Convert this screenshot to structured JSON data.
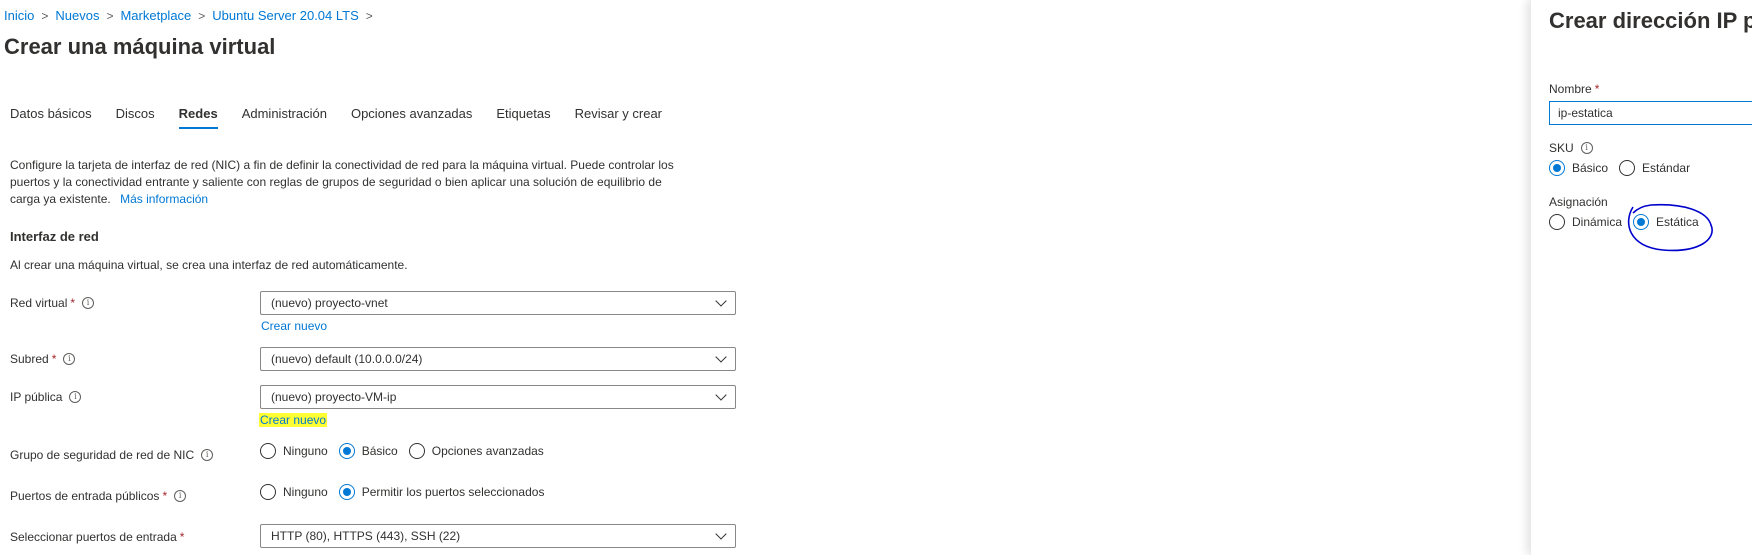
{
  "breadcrumb": {
    "items": [
      "Inicio",
      "Nuevos",
      "Marketplace",
      "Ubuntu Server 20.04 LTS"
    ],
    "separator": ">"
  },
  "page_title": "Crear una máquina virtual",
  "tabs": [
    "Datos básicos",
    "Discos",
    "Redes",
    "Administración",
    "Opciones avanzadas",
    "Etiquetas",
    "Revisar y crear"
  ],
  "active_tab": "Redes",
  "description": {
    "text": "Configure la tarjeta de interfaz de red (NIC) a fin de definir la conectividad de red para la máquina virtual. Puede controlar los puertos y la conectividad entrante y saliente con reglas de grupos de seguridad o bien aplicar una solución de equilibrio de carga ya existente.",
    "link": "Más información"
  },
  "network_interface": {
    "heading": "Interfaz de red",
    "note": "Al crear una máquina virtual, se crea una interfaz de red automáticamente."
  },
  "fields": {
    "vnet": {
      "label": "Red virtual",
      "required": "*",
      "value": "(nuevo) proyecto-vnet",
      "create_link": "Crear nuevo"
    },
    "subnet": {
      "label": "Subred",
      "required": "*",
      "value": "(nuevo) default (10.0.0.0/24)"
    },
    "public_ip": {
      "label": "IP pública",
      "value": "(nuevo) proyecto-VM-ip",
      "create_link": "Crear nuevo"
    },
    "nsg": {
      "label": "Grupo de seguridad de red de NIC",
      "options": [
        "Ninguno",
        "Básico",
        "Opciones avanzadas"
      ],
      "selected": "Básico"
    },
    "inbound": {
      "label": "Puertos de entrada públicos",
      "required": "*",
      "options": [
        "Ninguno",
        "Permitir los puertos seleccionados"
      ],
      "selected": "Permitir los puertos seleccionados"
    },
    "ports": {
      "label": "Seleccionar puertos de entrada",
      "required": "*",
      "value": "HTTP (80), HTTPS (443), SSH (22)"
    }
  },
  "side_panel": {
    "title": "Crear dirección IP pública",
    "name_label": "Nombre",
    "name_required": "*",
    "name_value": "ip-estatica",
    "sku_label": "SKU",
    "sku_options": [
      "Básico",
      "Estándar"
    ],
    "sku_selected": "Básico",
    "assignment_label": "Asignación",
    "assignment_options": [
      "Dinámica",
      "Estática"
    ],
    "assignment_selected": "Estática"
  },
  "colors": {
    "accent": "#0078d4",
    "required": "#a4262c",
    "highlight": "#ffff33",
    "annotation": "#0000cc"
  },
  "icons": [
    "info-icon",
    "chevron-down-icon",
    "radio-button"
  ]
}
